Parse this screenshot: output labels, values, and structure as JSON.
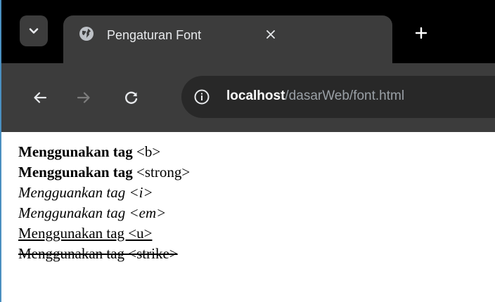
{
  "browser": {
    "tab": {
      "title": "Pengaturan Font",
      "favicon": "globe-icon",
      "close_icon": "close-icon"
    },
    "tab_search_icon": "chevron-down-icon",
    "new_tab_icon": "plus-icon",
    "toolbar": {
      "back_icon": "arrow-left-icon",
      "forward_icon": "arrow-right-icon",
      "reload_icon": "reload-icon",
      "site_info_icon": "info-icon"
    },
    "address": {
      "host": "localhost",
      "path": "/dasarWeb/font.html"
    },
    "colors": {
      "tabstrip_bg": "#000000",
      "toolbar_bg": "#3c3c3c",
      "omnibox_bg": "#282828",
      "url_path": "#9aa0a6"
    }
  },
  "page": {
    "lines": [
      {
        "text": "Menggunakan tag",
        "tag": "<b>",
        "style": "bold"
      },
      {
        "text": "Menggunakan tag",
        "tag": "<strong>",
        "style": "bold"
      },
      {
        "text": "Mengguankan tag <i>",
        "style": "italic"
      },
      {
        "text": "Menggunakan tag <em>",
        "style": "italic"
      },
      {
        "text": "Menggunakan tag <u>",
        "style": "underline"
      },
      {
        "text": "Menggunakan tag <strike>",
        "style": "strike"
      }
    ]
  }
}
